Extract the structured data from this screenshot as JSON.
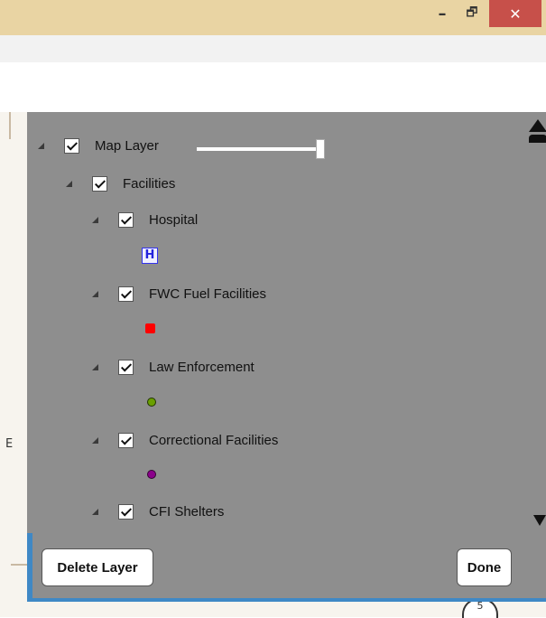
{
  "window": {
    "minimize_glyph": "–",
    "maximize_glyph": "🗗",
    "close_glyph": "✕",
    "titlebar_color": "#e9d4a3",
    "close_color": "#c7504a"
  },
  "map": {
    "left_label": "E",
    "road_shield_text": "5"
  },
  "layer_panel": {
    "background_color": "#8e8e8e",
    "accent_color": "#3f88c5",
    "root": {
      "label": "Map Layer",
      "checked": true,
      "opacity_slider_level": 1.0
    },
    "group": {
      "label": "Facilities",
      "checked": true
    },
    "layers": [
      {
        "label": "Hospital",
        "checked": true,
        "symbol": "hospital-H-icon",
        "symbol_text": "H",
        "symbol_color": "#3333ee"
      },
      {
        "label": "FWC Fuel Facilities",
        "checked": true,
        "symbol": "red-square-marker",
        "symbol_color": "#ff0000"
      },
      {
        "label": "Law Enforcement",
        "checked": true,
        "symbol": "green-dot-marker",
        "symbol_color": "#6aa000"
      },
      {
        "label": "Correctional Facilities",
        "checked": true,
        "symbol": "purple-dot-marker",
        "symbol_color": "#8b008b"
      },
      {
        "label": "CFI Shelters",
        "checked": true
      }
    ],
    "delete_label": "Delete Layer",
    "done_label": "Done"
  }
}
